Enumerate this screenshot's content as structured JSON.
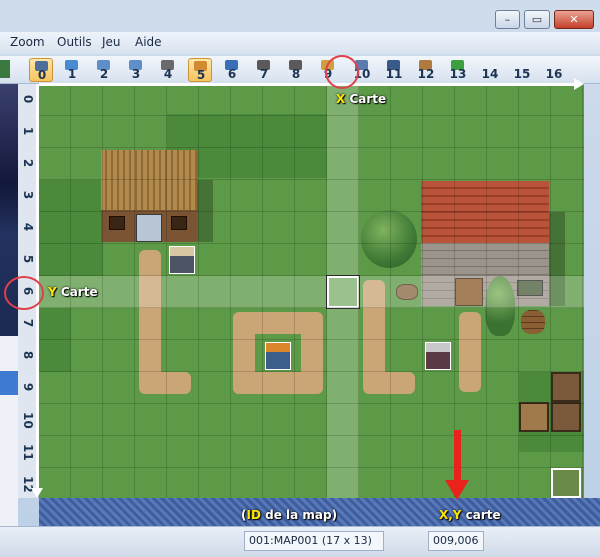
{
  "window": {
    "minimize_icon": "minimize-icon",
    "maximize_icon": "maximize-icon",
    "close_icon": "close-icon"
  },
  "menu": [
    "Zoom",
    "Outils",
    "Jeu",
    "Aide"
  ],
  "toolbar": {
    "tools": [
      {
        "num": "0",
        "icon": "layer-icon",
        "color": "#4f6f9a",
        "active": true
      },
      {
        "num": "1",
        "icon": "pencil-icon",
        "color": "#4a8ad0"
      },
      {
        "num": "2",
        "icon": "rectangle-icon",
        "color": "#5f8fc8"
      },
      {
        "num": "3",
        "icon": "ellipse-icon",
        "color": "#5f8fc8"
      },
      {
        "num": "4",
        "icon": "fill-icon",
        "color": "#6a6a6a"
      },
      {
        "num": "5",
        "icon": "shadow-pen-icon",
        "color": "#d08a30",
        "active": true
      },
      {
        "num": "6",
        "icon": "event-icon",
        "color": "#3a6fb8"
      },
      {
        "num": "7",
        "icon": "zoom-in-icon",
        "color": "#5a5a5a"
      },
      {
        "num": "8",
        "icon": "zoom-out-icon",
        "color": "#5a5a5a"
      },
      {
        "num": "9",
        "icon": "zoom-fit-icon",
        "color": "#d0a040"
      },
      {
        "num": "10",
        "icon": "map-icon",
        "color": "#5a7ab0"
      },
      {
        "num": "11",
        "icon": "database-icon",
        "color": "#3a5a8a"
      },
      {
        "num": "12",
        "icon": "resource-icon",
        "color": "#b07a40"
      },
      {
        "num": "13",
        "icon": "play-icon",
        "color": "#3aa040"
      },
      {
        "num": "14",
        "icon": "",
        "color": ""
      },
      {
        "num": "15",
        "icon": "",
        "color": ""
      },
      {
        "num": "16",
        "icon": "",
        "color": ""
      }
    ]
  },
  "ruler": {
    "rows": [
      "0",
      "1",
      "2",
      "3",
      "4",
      "5",
      "6",
      "7",
      "8",
      "9",
      "10",
      "11",
      "12"
    ]
  },
  "annotations": {
    "x_label": "Carte",
    "x_prefix": "X",
    "y_label": "Carte",
    "y_prefix": "Y",
    "id_label_open": "(",
    "id_label_bold": "ID",
    "id_label_rest": " de la map)",
    "xy_label_bold": "X,Y",
    "xy_label_rest": " carte",
    "highlight_color": "#e0404a"
  },
  "statusbar": {
    "map_info": "001:MAP001 (17 x 13)",
    "coords": "009,006"
  }
}
